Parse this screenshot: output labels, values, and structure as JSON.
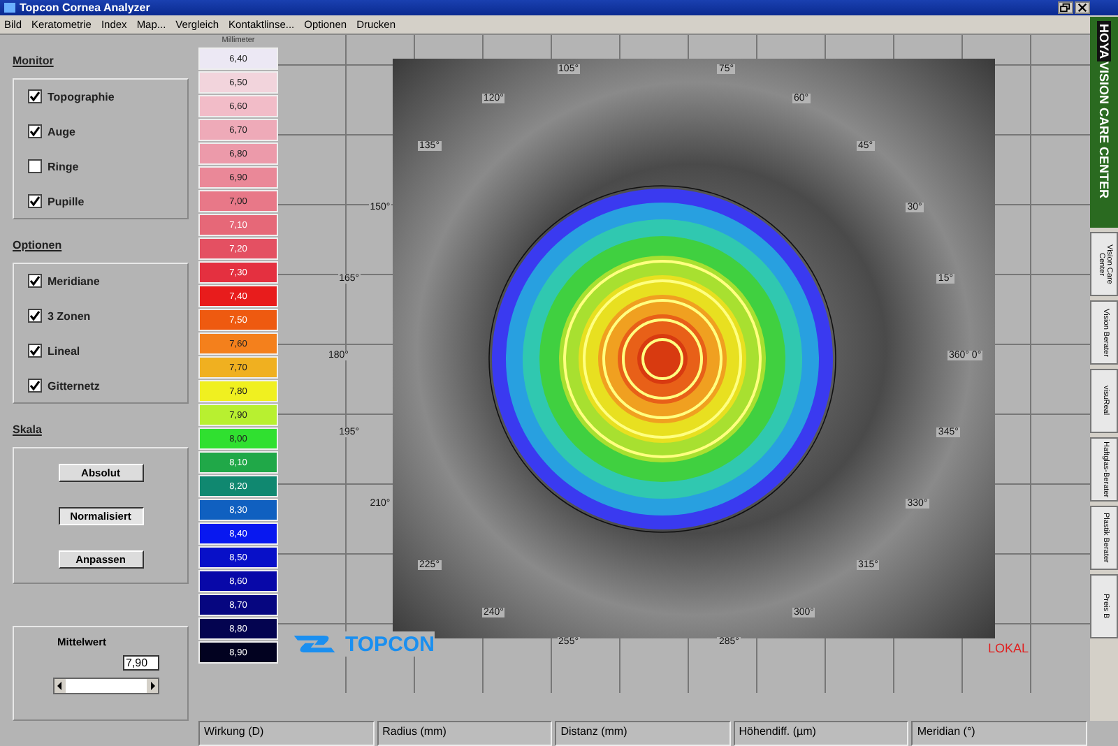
{
  "window": {
    "title": "Topcon Cornea Analyzer"
  },
  "menu": [
    "Bild",
    "Keratometrie",
    "Index",
    "Map...",
    "Vergleich",
    "Kontaktlinse...",
    "Optionen",
    "Drucken"
  ],
  "monitor": {
    "title": "Monitor",
    "items": [
      {
        "label": "Topographie",
        "checked": true
      },
      {
        "label": "Auge",
        "checked": true
      },
      {
        "label": "Ringe",
        "checked": false
      },
      {
        "label": "Pupille",
        "checked": true
      }
    ]
  },
  "optionen": {
    "title": "Optionen",
    "items": [
      {
        "label": "Meridiane",
        "checked": true
      },
      {
        "label": "3 Zonen",
        "checked": true
      },
      {
        "label": "Lineal",
        "checked": true
      },
      {
        "label": "Gitternetz",
        "checked": true
      }
    ]
  },
  "skala": {
    "title": "Skala",
    "buttons": [
      {
        "label": "Absolut",
        "selected": false
      },
      {
        "label": "Normalisiert",
        "selected": true
      },
      {
        "label": "Anpassen",
        "selected": false
      }
    ]
  },
  "mittelwert": {
    "label": "Mittelwert",
    "value": "7,90"
  },
  "scale": {
    "caption": "Millimeter",
    "items": [
      {
        "label": "6,40",
        "color": "#ece8f4"
      },
      {
        "label": "6,50",
        "color": "#f2d4dc"
      },
      {
        "label": "6,60",
        "color": "#f2bcc8"
      },
      {
        "label": "6,70",
        "color": "#eeaab8"
      },
      {
        "label": "6,80",
        "color": "#ec9aaa"
      },
      {
        "label": "6,90",
        "color": "#ea8898"
      },
      {
        "label": "7,00",
        "color": "#e87888"
      },
      {
        "label": "7,10",
        "color": "#e66878"
      },
      {
        "label": "7,20",
        "color": "#e45062"
      },
      {
        "label": "7,30",
        "color": "#e43040"
      },
      {
        "label": "7,40",
        "color": "#e81c1c"
      },
      {
        "label": "7,50",
        "color": "#ee5a10"
      },
      {
        "label": "7,60",
        "color": "#f4801c"
      },
      {
        "label": "7,70",
        "color": "#f0b020"
      },
      {
        "label": "7,80",
        "color": "#f0f020"
      },
      {
        "label": "7,90",
        "color": "#b8f030"
      },
      {
        "label": "8,00",
        "color": "#30e030"
      },
      {
        "label": "8,10",
        "color": "#20a848"
      },
      {
        "label": "8,20",
        "color": "#108870"
      },
      {
        "label": "8,30",
        "color": "#1060c0"
      },
      {
        "label": "8,40",
        "color": "#0818f0"
      },
      {
        "label": "8,50",
        "color": "#0810c8"
      },
      {
        "label": "8,60",
        "color": "#0808a8"
      },
      {
        "label": "8,70",
        "color": "#060680"
      },
      {
        "label": "8,80",
        "color": "#040450"
      },
      {
        "label": "8,90",
        "color": "#020220"
      }
    ]
  },
  "angles": [
    "105°",
    "75°",
    "120°",
    "60°",
    "135°",
    "45°",
    "150°",
    "30°",
    "165°",
    "15°",
    "180°",
    "360° 0°",
    "195°",
    "345°",
    "210°",
    "330°",
    "225°",
    "315°",
    "240°",
    "300°",
    "255°",
    "285°"
  ],
  "logo": "TOPCON",
  "mode": "LOKAL",
  "status_bar": [
    "Wirkung (D)",
    "Radius (mm)",
    "Distanz (mm)",
    "Höhendiff. (µm)",
    "Meridian (°)"
  ],
  "sidebar": {
    "banner_brand": "HOYA",
    "banner_text": "VISION CARE CENTER",
    "tabs": [
      "Vision Care Center",
      "Vision Berater",
      "visuReal",
      "Haftglas-Berater",
      "Plastik Berater",
      "Preis B"
    ]
  }
}
